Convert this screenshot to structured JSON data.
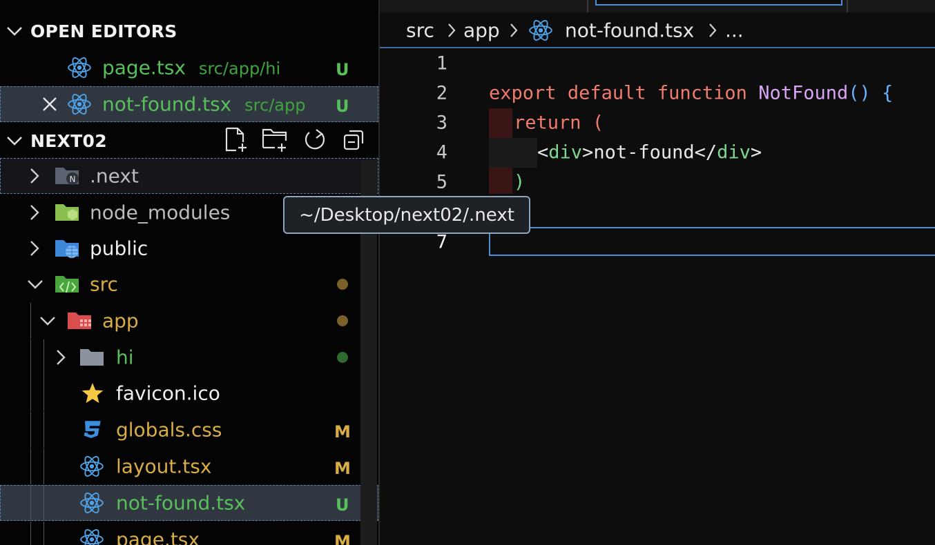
{
  "open_editors": {
    "title": "OPEN EDITORS",
    "items": [
      {
        "name": "page.tsx",
        "path": "src/app/hi",
        "badge": "U"
      },
      {
        "name": "not-found.tsx",
        "path": "src/app",
        "badge": "U"
      }
    ]
  },
  "explorer": {
    "title": "NEXT02",
    "tree": [
      {
        "label": ".next"
      },
      {
        "label": "node_modules"
      },
      {
        "label": "public"
      },
      {
        "label": "src"
      },
      {
        "label": "app"
      },
      {
        "label": "hi"
      },
      {
        "label": "favicon.ico"
      },
      {
        "label": "globals.css",
        "badge": "M"
      },
      {
        "label": "layout.tsx",
        "badge": "M"
      },
      {
        "label": "not-found.tsx",
        "badge": "U"
      },
      {
        "label": "page.tsx",
        "badge": "M"
      }
    ]
  },
  "tooltip": "~/Desktop/next02/.next",
  "breadcrumb": {
    "items": [
      "src",
      "app",
      "not-found.tsx",
      "..."
    ]
  },
  "editor": {
    "line_numbers": [
      "1",
      "2",
      "3",
      "4",
      "5",
      "7"
    ],
    "line2": {
      "kw1": "export",
      "kw2": "default",
      "kw3": "function",
      "fn": "NotFound",
      "parens": "()",
      "brace": "{"
    },
    "line3": {
      "kw": "return",
      "paren": "("
    },
    "line4": {
      "open_lt": "<",
      "tag1": "div",
      "gt1": ">",
      "text": "not-found",
      "close_lt": "</",
      "tag2": "div",
      "gt2": ">"
    },
    "line5": {
      "paren": ")"
    }
  },
  "colors": {
    "untracked": "#58c05a",
    "modified": "#d9ad45",
    "accent": "#4d8fd8"
  },
  "icons": [
    "chevron-down-icon",
    "react-icon",
    "close-icon",
    "new-file-icon",
    "new-folder-icon",
    "refresh-icon",
    "collapse-all-icon",
    "chevron-right-icon",
    "folder-icon",
    "star-icon",
    "css-icon"
  ]
}
